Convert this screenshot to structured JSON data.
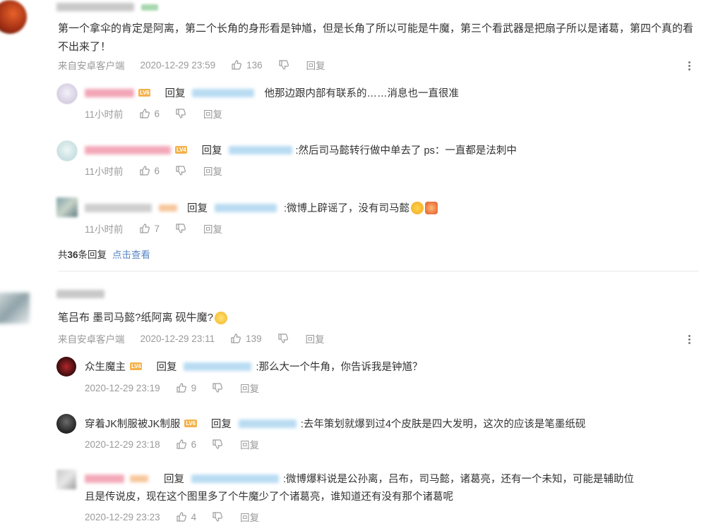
{
  "comments": [
    {
      "text": "第一个拿伞的肯定是阿离，第二个长角的身形看是钟馗，但是长角了所以可能是牛魔，第三个看武器是把扇子所以是诸葛，第四个真的看不出来了！",
      "source": "来自安卓客户端",
      "time": "2020-12-29 23:59",
      "likes": "136",
      "reply_label": "回复",
      "replies": [
        {
          "badge": "LV6",
          "reply_word": "回复",
          "text": "他那边跟内部有联系的……消息也一直很准",
          "time": "11小时前",
          "likes": "6",
          "reply_label": "回复"
        },
        {
          "badge": "LV4",
          "reply_word": "回复",
          "text": ":然后司马懿转行做中单去了 ps：一直都是法刺中",
          "time": "11小时前",
          "likes": "6",
          "reply_label": "回复"
        },
        {
          "reply_word": "回复",
          "text": ":微博上辟谣了，没有司马懿",
          "time": "11小时前",
          "likes": "7",
          "reply_label": "回复"
        }
      ],
      "collapse_prefix": "共",
      "collapse_count": "36",
      "collapse_suffix": "条回复",
      "collapse_link": "点击查看"
    },
    {
      "text": "笔吕布 墨司马懿?纸阿离 砚牛魔?",
      "source": "来自安卓客户端",
      "time": "2020-12-29 23:11",
      "likes": "139",
      "reply_label": "回复",
      "replies": [
        {
          "username": "众生魔主",
          "badge": "LV4",
          "reply_word": "回复",
          "text": ":那么大一个牛角，你告诉我是钟馗？",
          "time": "2020-12-29 23:19",
          "likes": "9",
          "reply_label": "回复"
        },
        {
          "username": "穿着JK制服被JK制服",
          "badge": "LV6",
          "reply_word": "回复",
          "text": ":去年策划就爆到过4个皮肤是四大发明，这次的应该是笔墨纸砚",
          "time": "2020-12-29 23:18",
          "likes": "6",
          "reply_label": "回复"
        },
        {
          "reply_word": "回复",
          "text_line1": ":微博爆料说是公孙离，吕布，司马懿，诸葛亮，还有一个未知，可能是辅助位",
          "text_line2": "且是传说皮，现在这个图里多了个牛魔少了个诸葛亮，谁知道还有没有那个诸葛呢",
          "time": "2020-12-29 23:23",
          "likes": "4",
          "reply_label": "回复"
        }
      ]
    }
  ],
  "colors": {
    "link": "#5a88c6",
    "meta": "#9a9a9a",
    "badge": "#f3b24b"
  },
  "icons": {
    "like": "thumbs-up-icon",
    "dislike": "thumbs-down-icon",
    "more": "more-vertical-icon"
  }
}
